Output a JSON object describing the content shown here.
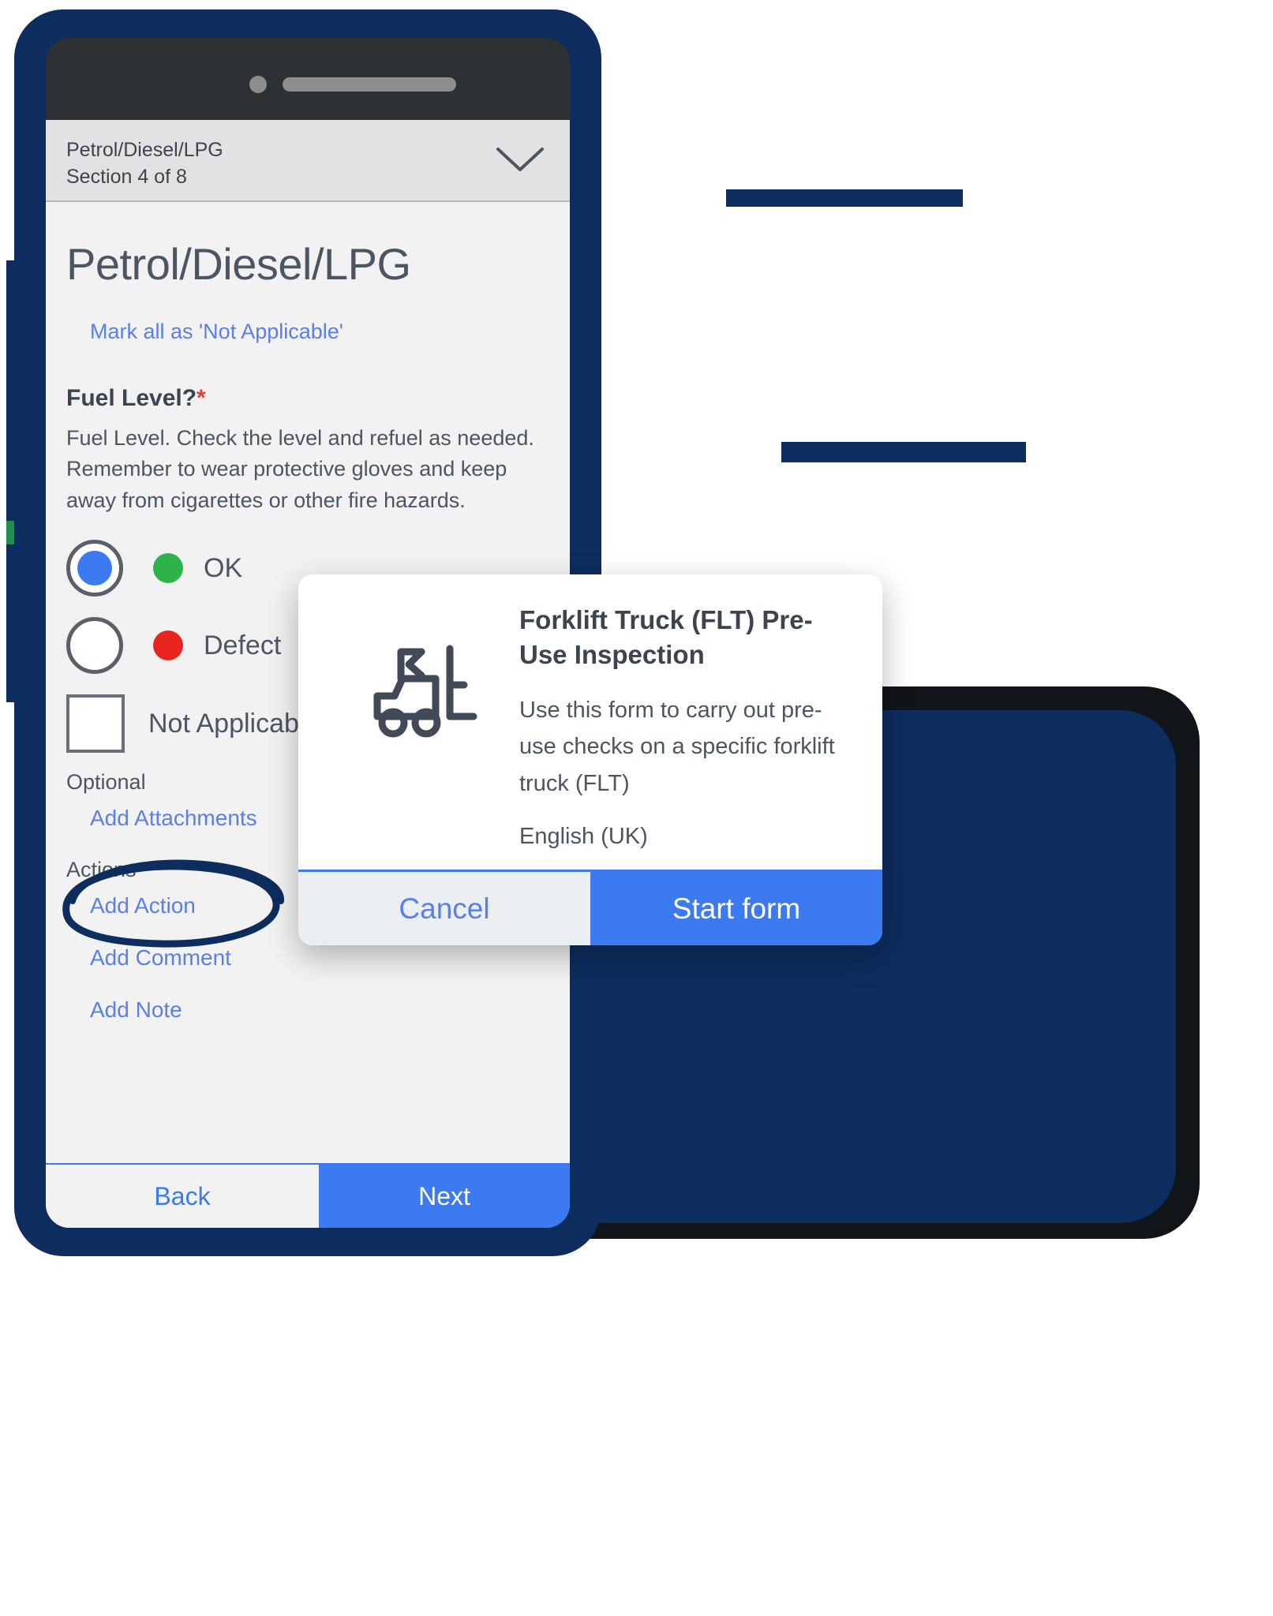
{
  "phone": {
    "section_bar": {
      "title": "Petrol/Diesel/LPG",
      "subtitle": "Section 4 of 8",
      "chevron_icon": "chevron-down-icon"
    },
    "page_title": "Petrol/Diesel/LPG",
    "mark_all_link": "Mark all as 'Not Applicable'",
    "question": {
      "label": "Fuel Level?",
      "required_marker": "*",
      "description": "Fuel Level. Check the level and refuel as needed. Remember to wear protective gloves and keep away from cigarettes or other fire hazards.",
      "options": [
        {
          "label": "OK",
          "status_color": "#2eb34a",
          "selected": true
        },
        {
          "label": "Defect",
          "status_color": "#e8261f",
          "selected": false
        }
      ],
      "not_applicable": {
        "label": "Not Applicable",
        "checked": false
      }
    },
    "optional_group": {
      "label": "Optional",
      "links": [
        "Add Attachments"
      ]
    },
    "actions_group": {
      "label": "Actions",
      "links": [
        "Add Action",
        "Add Comment",
        "Add Note"
      ]
    },
    "bottom_nav": {
      "back_label": "Back",
      "next_label": "Next"
    }
  },
  "modal": {
    "icon": "forklift-truck-icon",
    "title": "Forklift Truck (FLT) Pre-Use Inspection",
    "description": "Use this form to carry out pre-use checks on a specific forklift truck (FLT)",
    "language": "English (UK)",
    "cancel_label": "Cancel",
    "start_label": "Start form"
  },
  "annotation": {
    "type": "hand-drawn-ellipse",
    "target": "Add Attachments",
    "color": "#0d2d5e"
  },
  "colors": {
    "brand_navy": "#0d2d5e",
    "accent_blue": "#3b7af0",
    "link_blue": "#5b7fe8",
    "required_red": "#e04526",
    "ok_green": "#2eb34a",
    "defect_red": "#e8261f",
    "screen_bg": "#f2f2f2",
    "section_bg": "#e2e2e2"
  }
}
